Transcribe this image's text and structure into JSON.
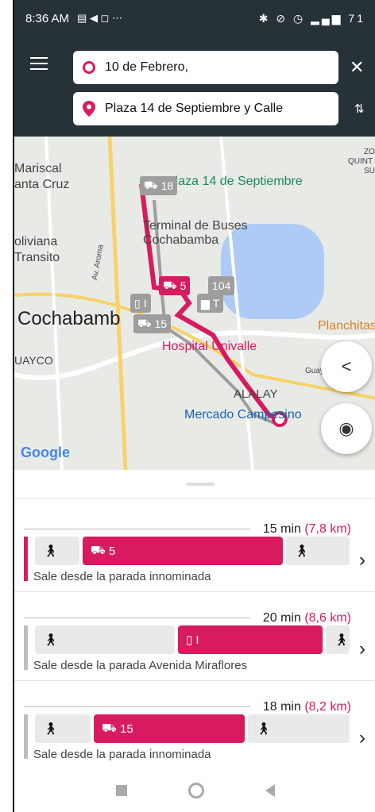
{
  "status": {
    "time": "8:36 AM",
    "left_icons": "▤ ◀ ◻ ⋯",
    "right_icons": "✱ ⊘ ◷ ▂▄▆ 71"
  },
  "search": {
    "origin": "10 de Febrero,",
    "destination": "Plaza 14 de Septiembre y Calle"
  },
  "map": {
    "labels": {
      "mariscal": "Mariscal",
      "santa_cruz": "anta Cruz",
      "boliviana": "oliviana",
      "transito": "Transito",
      "plaza": "Plaza 14 de Septiembre",
      "terminal": "Terminal de Buses",
      "terminal2": "Cochabamba",
      "cochabamba": "Cochabamb",
      "hospital": "Hospital Univalle",
      "uayco": "UAYCO",
      "planchitas": "Planchitas",
      "alalay": "ALALAY",
      "mercado": "Mercado Campesino",
      "aroma": "Av. Aroma",
      "quintanilla": "QUINT",
      "zo": "ZO",
      "su": "SU",
      "guay": "Guay"
    },
    "chips": {
      "bus18": "18",
      "bus5": "5",
      "n104": "104",
      "bus15": "15",
      "rail": "I",
      "car": "T"
    },
    "google": "Google"
  },
  "routes": [
    {
      "time": "15 min",
      "distance": "(7,8 km)",
      "mode_label": "5",
      "desc": "Sale desde la parada innominada"
    },
    {
      "time": "20 min",
      "distance": "(8,6 km)",
      "mode_label": "I",
      "desc": "Sale desde la parada Avenida Miraflores"
    },
    {
      "time": "18 min",
      "distance": "(8,2 km)",
      "mode_label": "15",
      "desc": "Sale desde la parada innominada"
    }
  ],
  "colors": {
    "accent": "#d81b60",
    "appbar": "#263238",
    "fab": "#4aa39a"
  },
  "icons": {
    "walk": "walk-icon",
    "bus": "bus-icon",
    "rail": "rail-icon",
    "chevron": "chevron-right-icon",
    "share": "share-icon",
    "locate": "my-location-icon",
    "directions": "directions-icon"
  }
}
